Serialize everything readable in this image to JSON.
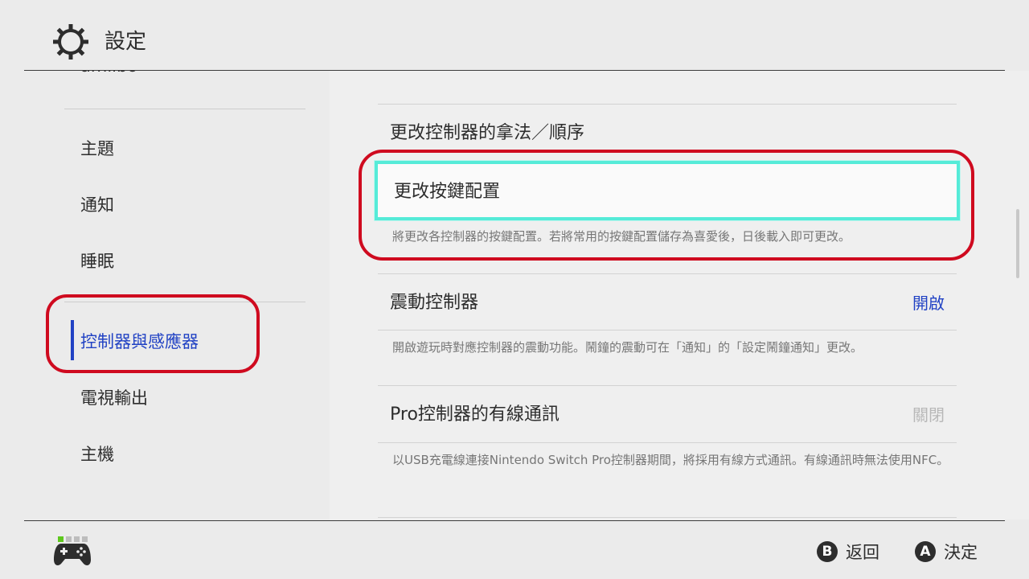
{
  "header": {
    "title": "設定",
    "icon": "gear-icon"
  },
  "sidebar": {
    "cut_item": "amiibo",
    "items": [
      {
        "label": "主題"
      },
      {
        "label": "通知"
      },
      {
        "label": "睡眠"
      },
      {
        "label": "控制器與感應器",
        "active": true
      },
      {
        "label": "電視輸出"
      },
      {
        "label": "主機"
      }
    ]
  },
  "main": {
    "item1": {
      "label": "更改控制器的拿法／順序"
    },
    "item2": {
      "label": "更改按鍵配置",
      "desc": "將更改各控制器的按鍵配置。若將常用的按鍵配置儲存為喜愛後，日後載入即可更改。"
    },
    "item3": {
      "label": "震動控制器",
      "value": "開啟",
      "desc": "開啟遊玩時對應控制器的震動功能。鬧鐘的震動可在「通知」的「設定鬧鐘通知」更改。"
    },
    "item4": {
      "label": "Pro控制器的有線通訊",
      "value": "關閉",
      "desc": "以USB充電線連接Nintendo Switch Pro控制器期間，將採用有線方式通訊。有線通訊時無法使用NFC。"
    }
  },
  "footer": {
    "back": {
      "key": "B",
      "label": "返回"
    },
    "ok": {
      "key": "A",
      "label": "決定"
    }
  },
  "colors": {
    "accent": "#2142c4",
    "selection": "#55ebd8",
    "highlight_ring": "#cf0a1f",
    "page_indicator": "#5ec81e"
  }
}
